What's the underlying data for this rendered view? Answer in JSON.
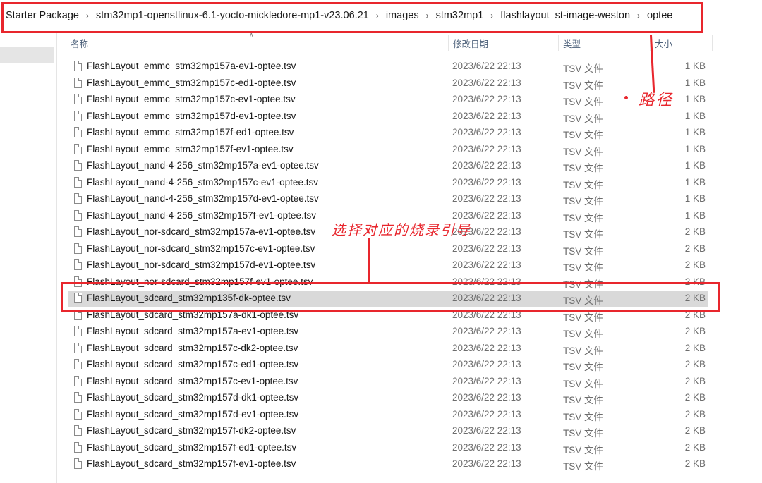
{
  "breadcrumb": [
    "Starter Package",
    "stm32mp1-openstlinux-6.1-yocto-mickledore-mp1-v23.06.21",
    "images",
    "stm32mp1",
    "flashlayout_st-image-weston",
    "optee"
  ],
  "columns": {
    "name": "名称",
    "date": "修改日期",
    "type": "类型",
    "size": "大小"
  },
  "files": [
    {
      "name": "FlashLayout_emmc_stm32mp157a-ev1-optee.tsv",
      "date": "2023/6/22 22:13",
      "type": "TSV 文件",
      "size": "1 KB"
    },
    {
      "name": "FlashLayout_emmc_stm32mp157c-ed1-optee.tsv",
      "date": "2023/6/22 22:13",
      "type": "TSV 文件",
      "size": "1 KB"
    },
    {
      "name": "FlashLayout_emmc_stm32mp157c-ev1-optee.tsv",
      "date": "2023/6/22 22:13",
      "type": "TSV 文件",
      "size": "1 KB"
    },
    {
      "name": "FlashLayout_emmc_stm32mp157d-ev1-optee.tsv",
      "date": "2023/6/22 22:13",
      "type": "TSV 文件",
      "size": "1 KB"
    },
    {
      "name": "FlashLayout_emmc_stm32mp157f-ed1-optee.tsv",
      "date": "2023/6/22 22:13",
      "type": "TSV 文件",
      "size": "1 KB"
    },
    {
      "name": "FlashLayout_emmc_stm32mp157f-ev1-optee.tsv",
      "date": "2023/6/22 22:13",
      "type": "TSV 文件",
      "size": "1 KB"
    },
    {
      "name": "FlashLayout_nand-4-256_stm32mp157a-ev1-optee.tsv",
      "date": "2023/6/22 22:13",
      "type": "TSV 文件",
      "size": "1 KB"
    },
    {
      "name": "FlashLayout_nand-4-256_stm32mp157c-ev1-optee.tsv",
      "date": "2023/6/22 22:13",
      "type": "TSV 文件",
      "size": "1 KB"
    },
    {
      "name": "FlashLayout_nand-4-256_stm32mp157d-ev1-optee.tsv",
      "date": "2023/6/22 22:13",
      "type": "TSV 文件",
      "size": "1 KB"
    },
    {
      "name": "FlashLayout_nand-4-256_stm32mp157f-ev1-optee.tsv",
      "date": "2023/6/22 22:13",
      "type": "TSV 文件",
      "size": "1 KB"
    },
    {
      "name": "FlashLayout_nor-sdcard_stm32mp157a-ev1-optee.tsv",
      "date": "2023/6/22 22:13",
      "type": "TSV 文件",
      "size": "2 KB"
    },
    {
      "name": "FlashLayout_nor-sdcard_stm32mp157c-ev1-optee.tsv",
      "date": "2023/6/22 22:13",
      "type": "TSV 文件",
      "size": "2 KB"
    },
    {
      "name": "FlashLayout_nor-sdcard_stm32mp157d-ev1-optee.tsv",
      "date": "2023/6/22 22:13",
      "type": "TSV 文件",
      "size": "2 KB"
    },
    {
      "name": "FlashLayout_nor-sdcard_stm32mp157f-ev1-optee.tsv",
      "date": "2023/6/22 22:13",
      "type": "TSV 文件",
      "size": "2 KB"
    },
    {
      "name": "FlashLayout_sdcard_stm32mp135f-dk-optee.tsv",
      "date": "2023/6/22 22:13",
      "type": "TSV 文件",
      "size": "2 KB",
      "selected": true
    },
    {
      "name": "FlashLayout_sdcard_stm32mp157a-dk1-optee.tsv",
      "date": "2023/6/22 22:13",
      "type": "TSV 文件",
      "size": "2 KB"
    },
    {
      "name": "FlashLayout_sdcard_stm32mp157a-ev1-optee.tsv",
      "date": "2023/6/22 22:13",
      "type": "TSV 文件",
      "size": "2 KB"
    },
    {
      "name": "FlashLayout_sdcard_stm32mp157c-dk2-optee.tsv",
      "date": "2023/6/22 22:13",
      "type": "TSV 文件",
      "size": "2 KB"
    },
    {
      "name": "FlashLayout_sdcard_stm32mp157c-ed1-optee.tsv",
      "date": "2023/6/22 22:13",
      "type": "TSV 文件",
      "size": "2 KB"
    },
    {
      "name": "FlashLayout_sdcard_stm32mp157c-ev1-optee.tsv",
      "date": "2023/6/22 22:13",
      "type": "TSV 文件",
      "size": "2 KB"
    },
    {
      "name": "FlashLayout_sdcard_stm32mp157d-dk1-optee.tsv",
      "date": "2023/6/22 22:13",
      "type": "TSV 文件",
      "size": "2 KB"
    },
    {
      "name": "FlashLayout_sdcard_stm32mp157d-ev1-optee.tsv",
      "date": "2023/6/22 22:13",
      "type": "TSV 文件",
      "size": "2 KB"
    },
    {
      "name": "FlashLayout_sdcard_stm32mp157f-dk2-optee.tsv",
      "date": "2023/6/22 22:13",
      "type": "TSV 文件",
      "size": "2 KB"
    },
    {
      "name": "FlashLayout_sdcard_stm32mp157f-ed1-optee.tsv",
      "date": "2023/6/22 22:13",
      "type": "TSV 文件",
      "size": "2 KB"
    },
    {
      "name": "FlashLayout_sdcard_stm32mp157f-ev1-optee.tsv",
      "date": "2023/6/22 22:13",
      "type": "TSV 文件",
      "size": "2 KB"
    }
  ],
  "annotations": {
    "path_label": "路径",
    "select_label": "选择对应的烧录引导",
    "color": "#e8262d"
  }
}
